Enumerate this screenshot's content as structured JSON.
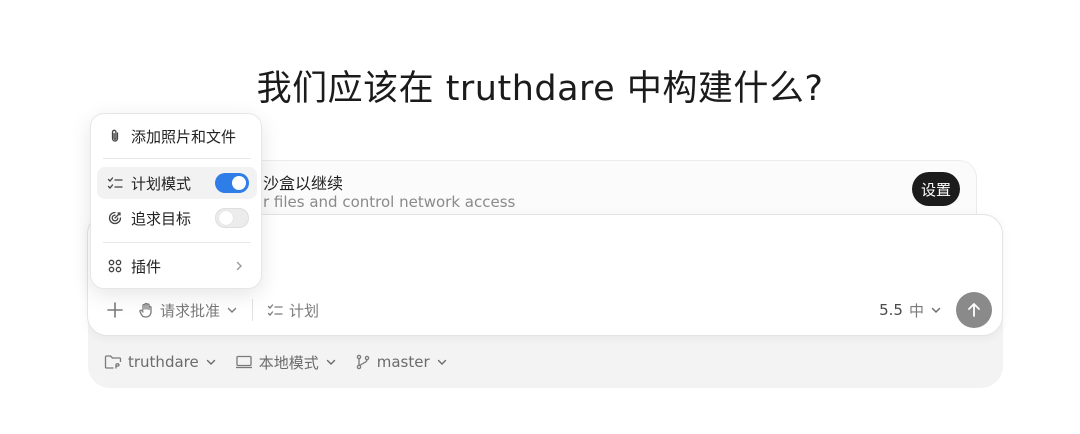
{
  "title": "我们应该在 truthdare 中构建什么?",
  "notice": {
    "title": "沙盒以继续",
    "subtitle": "r files and control network access",
    "button": "设置"
  },
  "composer": {
    "add_icon": "plus-icon",
    "approval_label": "请求批准",
    "plan_label": "计划",
    "model": "5.5",
    "level": "中",
    "send_icon": "arrow-up-icon"
  },
  "footer": {
    "project": "truthdare",
    "mode": "本地模式",
    "branch": "master"
  },
  "menu": {
    "attach": "添加照片和文件",
    "plan_mode": "计划模式",
    "plan_mode_on": true,
    "goal": "追求目标",
    "goal_on": false,
    "plugins": "插件"
  },
  "colors": {
    "toggle_on": "#2f7ee8",
    "send_button": "#8a8a8a"
  }
}
